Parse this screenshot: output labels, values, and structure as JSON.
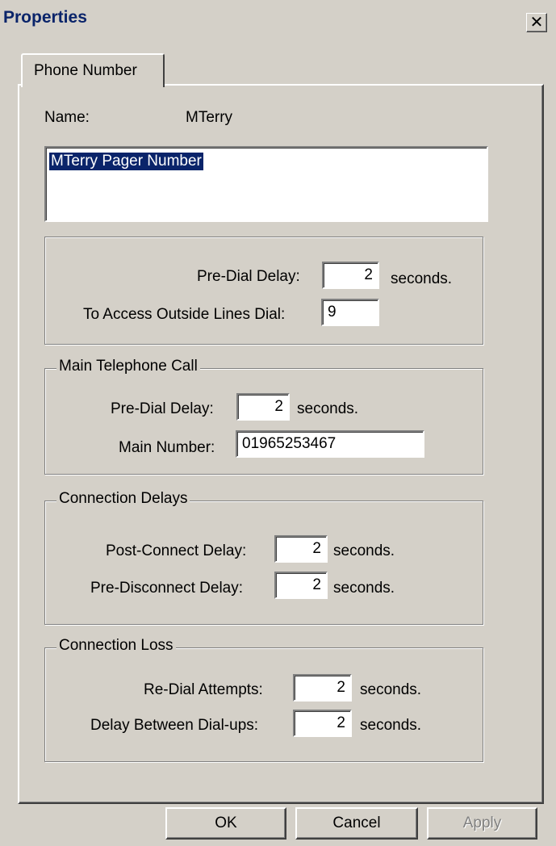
{
  "window": {
    "title": "Properties",
    "close_glyph": "✕"
  },
  "tabs": [
    {
      "label": "Phone Number"
    }
  ],
  "name_row": {
    "label": "Name:",
    "value": "MTerry"
  },
  "description": "MTerry Pager Number",
  "outside": {
    "pre_dial_label": "Pre-Dial Delay:",
    "pre_dial_value": "2",
    "pre_dial_unit": "seconds.",
    "access_label": "To Access Outside Lines Dial:",
    "access_value": "9"
  },
  "main_call": {
    "legend": "Main Telephone Call",
    "pre_dial_label": "Pre-Dial Delay:",
    "pre_dial_value": "2",
    "pre_dial_unit": "seconds.",
    "number_label": "Main Number:",
    "number_value": "01965253467"
  },
  "connection_delays": {
    "legend": "Connection Delays",
    "post_label": "Post-Connect Delay:",
    "post_value": "2",
    "post_unit": "seconds.",
    "pre_disc_label": "Pre-Disconnect Delay:",
    "pre_disc_value": "2",
    "pre_disc_unit": "seconds."
  },
  "connection_loss": {
    "legend": "Connection Loss",
    "redial_label": "Re-Dial Attempts:",
    "redial_value": "2",
    "redial_unit": "seconds.",
    "between_label": "Delay Between Dial-ups:",
    "between_value": "2",
    "between_unit": "seconds."
  },
  "buttons": {
    "ok": "OK",
    "cancel": "Cancel",
    "apply": "Apply"
  }
}
